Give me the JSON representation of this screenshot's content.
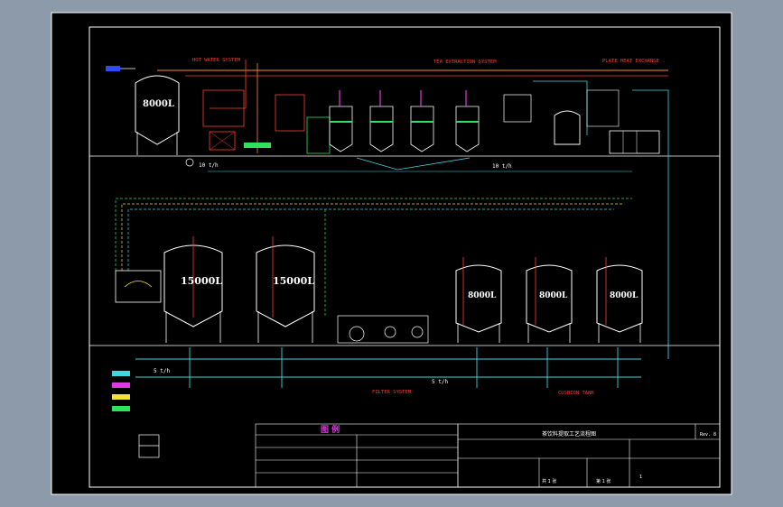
{
  "sections": {
    "hot_water": "HOT WATER SYSTEM",
    "tea_extraction": "TEA EXTRACTION SYSTEM",
    "plate_heat": "PLATE HEAT EXCHANGE",
    "filter": "FILTER SYSTEM",
    "cushion_tank": "CUSHION TANK"
  },
  "tanks": {
    "hot_water_tank": "8000L",
    "big_tank_1": "15000L",
    "big_tank_2": "15000L",
    "small_tank_1": "8000L",
    "small_tank_2": "8000L",
    "small_tank_3": "8000L"
  },
  "flow_labels": {
    "flow_a": "10 t/h",
    "flow_b": "10 t/h",
    "flow_c": "5 t/h",
    "flow_d": "5 t/h"
  },
  "legend": {
    "title": "图   例"
  },
  "title_block": {
    "drawing_title": "茶饮料提取工艺流程图",
    "rev": "Rev. 8",
    "sheet_a": "共 1 张",
    "sheet_b": "第 1 张",
    "scale": "1"
  },
  "colors": {
    "background": "#000000",
    "frame": "#ffffff",
    "pipe_cyan": "#3fd6e0",
    "pipe_red": "#ff3b30",
    "pipe_green": "#2ee05a",
    "pipe_yellow": "#f2e13a",
    "pipe_magenta": "#e23ae0",
    "pipe_orange": "#ff8a3a"
  }
}
